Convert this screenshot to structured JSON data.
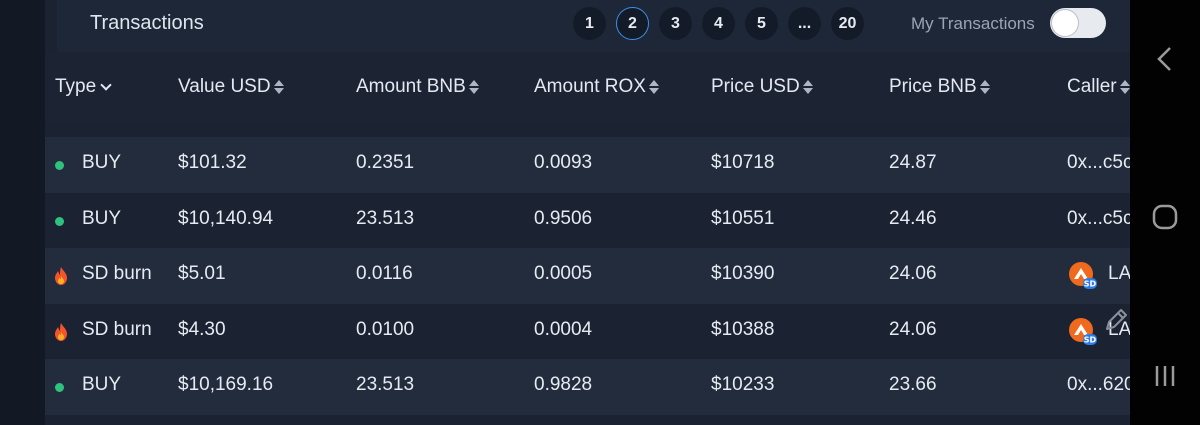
{
  "header": {
    "title": "Transactions",
    "pages": [
      "1",
      "2",
      "3",
      "4",
      "5",
      "...",
      "20"
    ],
    "active_page": "2",
    "my_transactions_label": "My Transactions",
    "my_transactions_on": false
  },
  "columns": {
    "type": "Type",
    "value_usd": "Value USD",
    "amount_bnb": "Amount BNB",
    "amount_rox": "Amount ROX",
    "price_usd": "Price USD",
    "price_bnb": "Price BNB",
    "caller": "Caller"
  },
  "rows": [
    {
      "type": "BUY",
      "kind": "buy",
      "value_usd": "$101.32",
      "amount_bnb": "0.2351",
      "amount_rox": "0.0093",
      "price_usd": "$10718",
      "price_bnb": "24.87",
      "caller": "0x...c5c"
    },
    {
      "type": "BUY",
      "kind": "buy",
      "value_usd": "$10,140.94",
      "amount_bnb": "23.513",
      "amount_rox": "0.9506",
      "price_usd": "$10551",
      "price_bnb": "24.46",
      "caller": "0x...c5c"
    },
    {
      "type": "SD burn",
      "kind": "burn",
      "value_usd": "$5.01",
      "amount_bnb": "0.0116",
      "amount_rox": "0.0005",
      "price_usd": "$10390",
      "price_bnb": "24.06",
      "caller": "LA"
    },
    {
      "type": "SD burn",
      "kind": "burn",
      "value_usd": "$4.30",
      "amount_bnb": "0.0100",
      "amount_rox": "0.0004",
      "price_usd": "$10388",
      "price_bnb": "24.06",
      "caller": "LA"
    },
    {
      "type": "BUY",
      "kind": "buy",
      "value_usd": "$10,169.16",
      "amount_bnb": "23.513",
      "amount_rox": "0.9828",
      "price_usd": "$10233",
      "price_bnb": "23.66",
      "caller": "0x...620"
    }
  ],
  "colors": {
    "buy_dot": "#2ec27e",
    "active_page_border": "#3b8fe6",
    "panel_bg": "#1b2332"
  },
  "icons": {
    "buy": "green-dot-icon",
    "burn": "fire-icon",
    "caller_avatar": "sd-token-avatar-icon"
  }
}
